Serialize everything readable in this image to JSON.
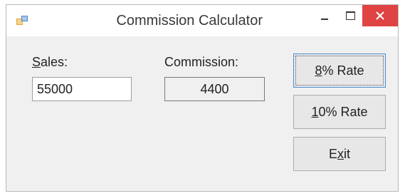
{
  "window": {
    "title": "Commission Calculator"
  },
  "icons": {
    "app": "app-window-icon",
    "minimize": "minimize-icon",
    "maximize": "maximize-icon",
    "close": "close-icon"
  },
  "colors": {
    "close_button": "#e04343",
    "focus_border": "#4b8fd6"
  },
  "form": {
    "sales_label_mnemonic": "S",
    "sales_label_rest": "ales:",
    "sales_value": "55000",
    "commission_label": "Commission:",
    "commission_value": "4400"
  },
  "buttons": {
    "rate8_mnemonic": "8",
    "rate8_rest": "% Rate",
    "rate10_mnemonic": "1",
    "rate10_rest": "0% Rate",
    "exit_before": "E",
    "exit_mnemonic": "x",
    "exit_after": "it"
  }
}
